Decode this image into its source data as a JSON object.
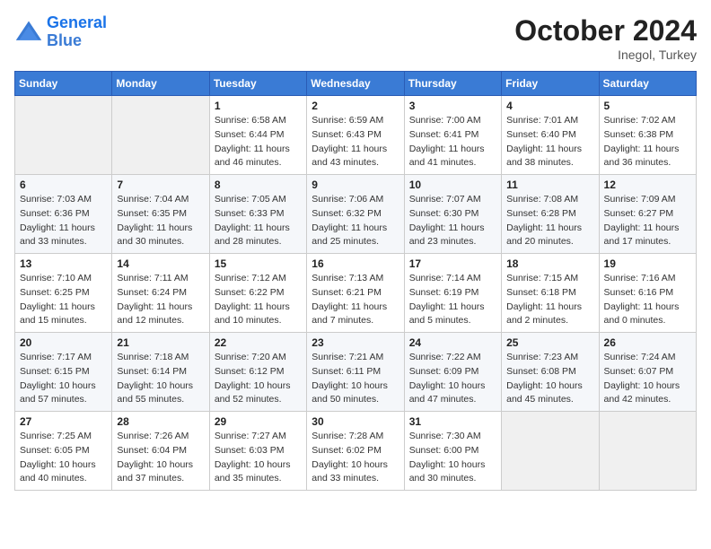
{
  "header": {
    "logo_line1": "General",
    "logo_line2": "Blue",
    "month_title": "October 2024",
    "location": "Inegol, Turkey"
  },
  "weekdays": [
    "Sunday",
    "Monday",
    "Tuesday",
    "Wednesday",
    "Thursday",
    "Friday",
    "Saturday"
  ],
  "weeks": [
    [
      {
        "day": "",
        "empty": true
      },
      {
        "day": "",
        "empty": true
      },
      {
        "day": "1",
        "sunrise": "Sunrise: 6:58 AM",
        "sunset": "Sunset: 6:44 PM",
        "daylight": "Daylight: 11 hours and 46 minutes."
      },
      {
        "day": "2",
        "sunrise": "Sunrise: 6:59 AM",
        "sunset": "Sunset: 6:43 PM",
        "daylight": "Daylight: 11 hours and 43 minutes."
      },
      {
        "day": "3",
        "sunrise": "Sunrise: 7:00 AM",
        "sunset": "Sunset: 6:41 PM",
        "daylight": "Daylight: 11 hours and 41 minutes."
      },
      {
        "day": "4",
        "sunrise": "Sunrise: 7:01 AM",
        "sunset": "Sunset: 6:40 PM",
        "daylight": "Daylight: 11 hours and 38 minutes."
      },
      {
        "day": "5",
        "sunrise": "Sunrise: 7:02 AM",
        "sunset": "Sunset: 6:38 PM",
        "daylight": "Daylight: 11 hours and 36 minutes."
      }
    ],
    [
      {
        "day": "6",
        "sunrise": "Sunrise: 7:03 AM",
        "sunset": "Sunset: 6:36 PM",
        "daylight": "Daylight: 11 hours and 33 minutes."
      },
      {
        "day": "7",
        "sunrise": "Sunrise: 7:04 AM",
        "sunset": "Sunset: 6:35 PM",
        "daylight": "Daylight: 11 hours and 30 minutes."
      },
      {
        "day": "8",
        "sunrise": "Sunrise: 7:05 AM",
        "sunset": "Sunset: 6:33 PM",
        "daylight": "Daylight: 11 hours and 28 minutes."
      },
      {
        "day": "9",
        "sunrise": "Sunrise: 7:06 AM",
        "sunset": "Sunset: 6:32 PM",
        "daylight": "Daylight: 11 hours and 25 minutes."
      },
      {
        "day": "10",
        "sunrise": "Sunrise: 7:07 AM",
        "sunset": "Sunset: 6:30 PM",
        "daylight": "Daylight: 11 hours and 23 minutes."
      },
      {
        "day": "11",
        "sunrise": "Sunrise: 7:08 AM",
        "sunset": "Sunset: 6:28 PM",
        "daylight": "Daylight: 11 hours and 20 minutes."
      },
      {
        "day": "12",
        "sunrise": "Sunrise: 7:09 AM",
        "sunset": "Sunset: 6:27 PM",
        "daylight": "Daylight: 11 hours and 17 minutes."
      }
    ],
    [
      {
        "day": "13",
        "sunrise": "Sunrise: 7:10 AM",
        "sunset": "Sunset: 6:25 PM",
        "daylight": "Daylight: 11 hours and 15 minutes."
      },
      {
        "day": "14",
        "sunrise": "Sunrise: 7:11 AM",
        "sunset": "Sunset: 6:24 PM",
        "daylight": "Daylight: 11 hours and 12 minutes."
      },
      {
        "day": "15",
        "sunrise": "Sunrise: 7:12 AM",
        "sunset": "Sunset: 6:22 PM",
        "daylight": "Daylight: 11 hours and 10 minutes."
      },
      {
        "day": "16",
        "sunrise": "Sunrise: 7:13 AM",
        "sunset": "Sunset: 6:21 PM",
        "daylight": "Daylight: 11 hours and 7 minutes."
      },
      {
        "day": "17",
        "sunrise": "Sunrise: 7:14 AM",
        "sunset": "Sunset: 6:19 PM",
        "daylight": "Daylight: 11 hours and 5 minutes."
      },
      {
        "day": "18",
        "sunrise": "Sunrise: 7:15 AM",
        "sunset": "Sunset: 6:18 PM",
        "daylight": "Daylight: 11 hours and 2 minutes."
      },
      {
        "day": "19",
        "sunrise": "Sunrise: 7:16 AM",
        "sunset": "Sunset: 6:16 PM",
        "daylight": "Daylight: 11 hours and 0 minutes."
      }
    ],
    [
      {
        "day": "20",
        "sunrise": "Sunrise: 7:17 AM",
        "sunset": "Sunset: 6:15 PM",
        "daylight": "Daylight: 10 hours and 57 minutes."
      },
      {
        "day": "21",
        "sunrise": "Sunrise: 7:18 AM",
        "sunset": "Sunset: 6:14 PM",
        "daylight": "Daylight: 10 hours and 55 minutes."
      },
      {
        "day": "22",
        "sunrise": "Sunrise: 7:20 AM",
        "sunset": "Sunset: 6:12 PM",
        "daylight": "Daylight: 10 hours and 52 minutes."
      },
      {
        "day": "23",
        "sunrise": "Sunrise: 7:21 AM",
        "sunset": "Sunset: 6:11 PM",
        "daylight": "Daylight: 10 hours and 50 minutes."
      },
      {
        "day": "24",
        "sunrise": "Sunrise: 7:22 AM",
        "sunset": "Sunset: 6:09 PM",
        "daylight": "Daylight: 10 hours and 47 minutes."
      },
      {
        "day": "25",
        "sunrise": "Sunrise: 7:23 AM",
        "sunset": "Sunset: 6:08 PM",
        "daylight": "Daylight: 10 hours and 45 minutes."
      },
      {
        "day": "26",
        "sunrise": "Sunrise: 7:24 AM",
        "sunset": "Sunset: 6:07 PM",
        "daylight": "Daylight: 10 hours and 42 minutes."
      }
    ],
    [
      {
        "day": "27",
        "sunrise": "Sunrise: 7:25 AM",
        "sunset": "Sunset: 6:05 PM",
        "daylight": "Daylight: 10 hours and 40 minutes."
      },
      {
        "day": "28",
        "sunrise": "Sunrise: 7:26 AM",
        "sunset": "Sunset: 6:04 PM",
        "daylight": "Daylight: 10 hours and 37 minutes."
      },
      {
        "day": "29",
        "sunrise": "Sunrise: 7:27 AM",
        "sunset": "Sunset: 6:03 PM",
        "daylight": "Daylight: 10 hours and 35 minutes."
      },
      {
        "day": "30",
        "sunrise": "Sunrise: 7:28 AM",
        "sunset": "Sunset: 6:02 PM",
        "daylight": "Daylight: 10 hours and 33 minutes."
      },
      {
        "day": "31",
        "sunrise": "Sunrise: 7:30 AM",
        "sunset": "Sunset: 6:00 PM",
        "daylight": "Daylight: 10 hours and 30 minutes."
      },
      {
        "day": "",
        "empty": true
      },
      {
        "day": "",
        "empty": true
      }
    ]
  ]
}
